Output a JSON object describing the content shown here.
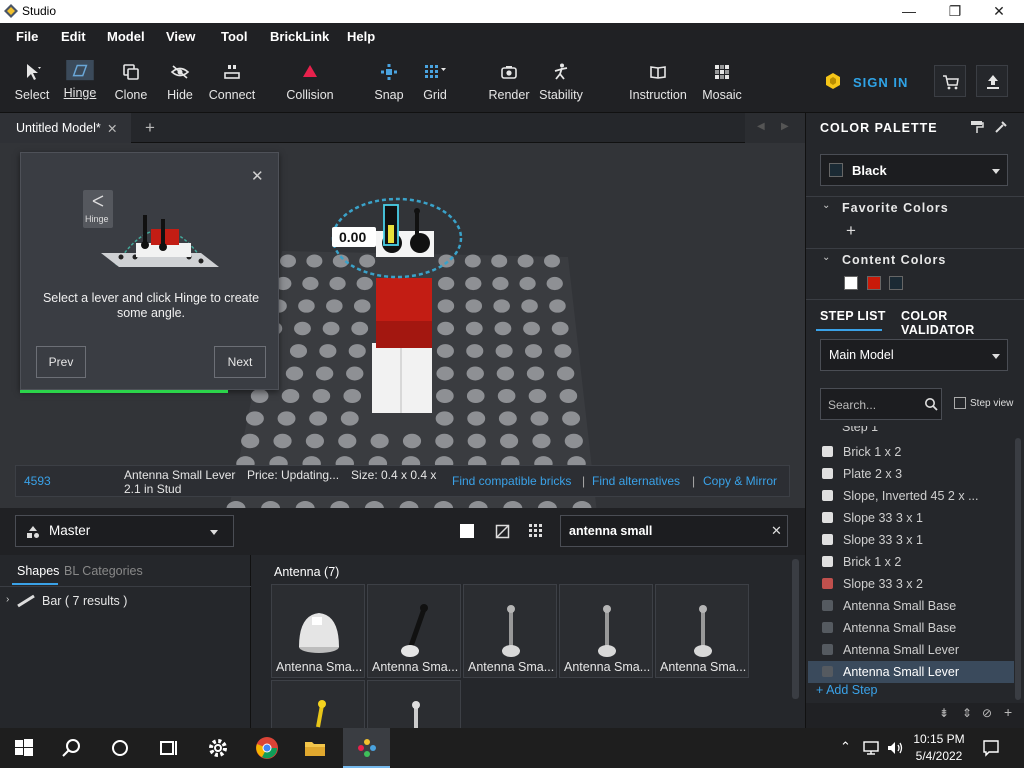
{
  "window": {
    "title": "Studio",
    "minimize": "—",
    "maximize": "❐",
    "close": "✕"
  },
  "menu": [
    "File",
    "Edit",
    "Model",
    "View",
    "Tool",
    "BrickLink",
    "Help"
  ],
  "toolbar": {
    "select": "Select",
    "hinge": "Hinge",
    "clone": "Clone",
    "hide": "Hide",
    "connect": "Connect",
    "collision": "Collision",
    "snap": "Snap",
    "grid": "Grid",
    "render": "Render",
    "stability": "Stability",
    "instruction": "Instruction",
    "mosaic": "Mosaic",
    "sign_in": "SIGN IN"
  },
  "tabs": {
    "active": "Untitled Model*",
    "close": "✕",
    "add": "+"
  },
  "tutorial": {
    "hinge_label": "Hinge",
    "text": "Select a lever and click Hinge to create some angle.",
    "prev": "Prev",
    "next": "Next",
    "close": "✕",
    "progress": 1.0
  },
  "viewport": {
    "angle_value": "0.00"
  },
  "info": {
    "part_id": "4593",
    "part_name": "Antenna Small Lever",
    "part_name2": "2.1 in Stud",
    "price": "Price: Updating...",
    "size": "Size: 0.4 x 0.4 x",
    "find_compatible": "Find compatible bricks",
    "sep1": "|",
    "find_alternatives": "Find alternatives",
    "sep2": "|",
    "copy_mirror": "Copy & Mirror"
  },
  "color_palette": {
    "title": "COLOR PALETTE",
    "selected": "Black",
    "favorite": "Favorite Colors",
    "add": "+",
    "content": "Content Colors",
    "content_colors": [
      "#ffffff",
      "#c91a09",
      "#1b2a34"
    ]
  },
  "step_tabs": {
    "step_list": "STEP LIST",
    "validator": "COLOR VALIDATOR"
  },
  "step_list": {
    "model": "Main Model",
    "search_placeholder": "Search...",
    "step_view": "Step view",
    "step_header": "Step 1",
    "items": [
      {
        "name": "Brick 1 x 2",
        "color": "#e0e0e0"
      },
      {
        "name": "Plate 2 x 3",
        "color": "#e0e0e0"
      },
      {
        "name": "Slope, Inverted 45 2 x ...",
        "color": "#e0e0e0"
      },
      {
        "name": "Slope 33 3 x 1",
        "color": "#e0e0e0"
      },
      {
        "name": "Slope 33 3 x 1",
        "color": "#e0e0e0"
      },
      {
        "name": "Brick 1 x 2",
        "color": "#e0e0e0"
      },
      {
        "name": "Slope 33 3 x 2",
        "color": "#c0504d"
      },
      {
        "name": "Antenna Small Base",
        "color": "#555a60"
      },
      {
        "name": "Antenna Small Base",
        "color": "#555a60"
      },
      {
        "name": "Antenna Small Lever",
        "color": "#555a60"
      },
      {
        "name": "Antenna Small Lever",
        "color": "#555a60"
      }
    ],
    "add_step": "+ Add Step"
  },
  "parts": {
    "palette": "Master",
    "search_value": "antenna small",
    "clear": "✕",
    "tab_shapes": "Shapes",
    "tab_categories": "BL Categories",
    "tree_item": "Bar ( 7 results )",
    "group": "Antenna (7)",
    "cards": [
      "Antenna Sma...",
      "Antenna Sma...",
      "Antenna Sma...",
      "Antenna Sma...",
      "Antenna Sma..."
    ]
  },
  "taskbar": {
    "time": "10:15 PM",
    "date": "5/4/2022"
  }
}
